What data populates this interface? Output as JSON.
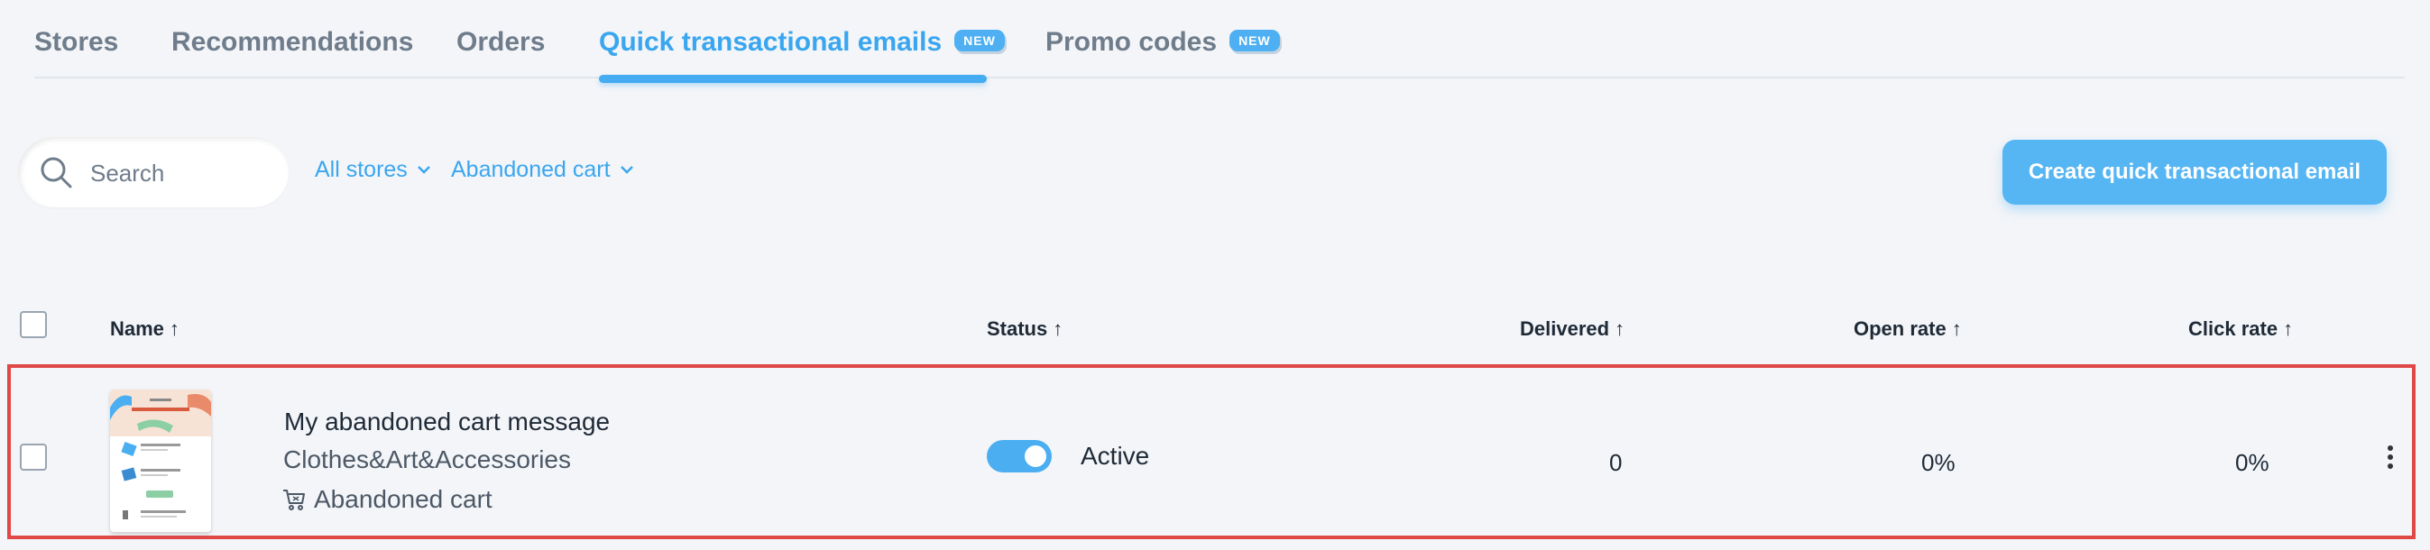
{
  "tabs": [
    {
      "label": "Stores"
    },
    {
      "label": "Recommendations"
    },
    {
      "label": "Orders"
    },
    {
      "label": "Quick transactional emails",
      "badge": "NEW",
      "active": true
    },
    {
      "label": "Promo codes",
      "badge": "NEW"
    }
  ],
  "search": {
    "placeholder": "Search",
    "value": ""
  },
  "filters": {
    "stores": "All stores",
    "type": "Abandoned cart"
  },
  "create_button": "Create quick transactional email",
  "table": {
    "columns": {
      "name": "Name",
      "status": "Status",
      "delivered": "Delivered",
      "open_rate": "Open rate",
      "click_rate": "Click rate"
    },
    "sort_arrow": "↑",
    "rows": [
      {
        "name": "My abandoned cart message",
        "store": "Clothes&Art&Accessories",
        "type": "Abandoned cart",
        "status": "Active",
        "status_on": true,
        "delivered": "0",
        "open_rate": "0%",
        "click_rate": "0%"
      }
    ]
  },
  "colors": {
    "accent": "#3aa6ef",
    "tab_inactive": "#6f7c8b",
    "highlight_border": "#e04848",
    "background": "#f3f5f8"
  },
  "icons": {
    "search": "search-icon",
    "dropdown": "chevron-down-icon",
    "cart": "cart-icon",
    "more": "more-vertical-icon",
    "sort": "arrow-up-icon"
  }
}
